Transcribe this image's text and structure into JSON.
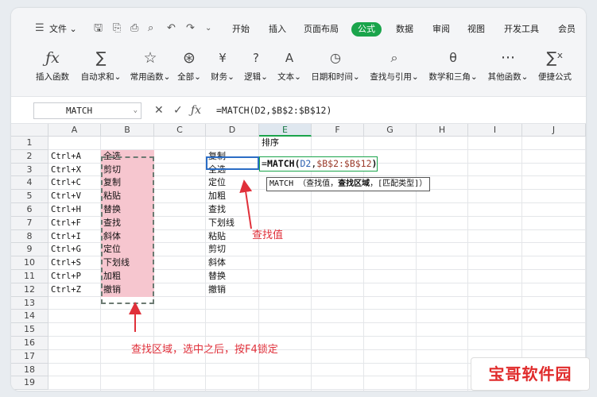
{
  "menubar": {
    "file_label": "文件",
    "items": [
      "开始",
      "插入",
      "页面布局",
      "公式",
      "数据",
      "审阅",
      "视图",
      "开发工具",
      "会员"
    ],
    "active": "公式"
  },
  "ribbon": {
    "buttons": [
      {
        "label": "插入函数",
        "icon": "fx-icon"
      },
      {
        "label": "自动求和",
        "icon": "sum-icon"
      },
      {
        "label": "常用函数",
        "icon": "star-icon"
      },
      {
        "label": "全部",
        "icon": "all-functions-icon"
      },
      {
        "label": "财务",
        "icon": "finance-icon"
      },
      {
        "label": "逻辑",
        "icon": "logic-icon"
      },
      {
        "label": "文本",
        "icon": "text-icon"
      },
      {
        "label": "日期和时间",
        "icon": "clock-icon"
      },
      {
        "label": "查找与引用",
        "icon": "lookup-icon"
      },
      {
        "label": "数学和三角",
        "icon": "math-icon"
      },
      {
        "label": "其他函数",
        "icon": "more-icon"
      },
      {
        "label": "便捷公式",
        "icon": "quick-formula-icon"
      }
    ]
  },
  "formula_bar": {
    "name_box": "MATCH",
    "formula": "=MATCH(D2,$B$2:$B$12)"
  },
  "columns": [
    "A",
    "B",
    "C",
    "D",
    "E",
    "F",
    "G",
    "H",
    "I",
    "J"
  ],
  "selected_column": "E",
  "rows": [
    "1",
    "2",
    "3",
    "4",
    "5",
    "6",
    "7",
    "8",
    "9",
    "10",
    "11",
    "12",
    "13",
    "14",
    "15",
    "16",
    "17",
    "18",
    "19"
  ],
  "col_a": [
    "Ctrl+A",
    "Ctrl+X",
    "Ctrl+C",
    "Ctrl+V",
    "Ctrl+H",
    "Ctrl+F",
    "Ctrl+I",
    "Ctrl+G",
    "Ctrl+S",
    "Ctrl+P",
    "Ctrl+Z"
  ],
  "col_b": [
    "全选",
    "剪切",
    "复制",
    "粘贴",
    "替换",
    "查找",
    "斜体",
    "定位",
    "下划线",
    "加粗",
    "撤销"
  ],
  "col_d": [
    "复制",
    "全选",
    "定位",
    "加粗",
    "查找",
    "下划线",
    "粘贴",
    "剪切",
    "斜体",
    "替换",
    "撤销"
  ],
  "e1": "排序",
  "edit_cell": {
    "eq": "=",
    "fn": "MATCH",
    "open": "(",
    "ref1": "D2",
    "comma": ",",
    "ref2": "$B$2:$B$12",
    "close": ")"
  },
  "tooltip": {
    "fn": "MATCH",
    "open": "（",
    "arg1": "查找值",
    "sep1": "，",
    "arg2": "查找区域",
    "sep2": "，",
    "arg3": "[匹配类型]",
    "close": "）"
  },
  "annotations": {
    "lookup_value": "查找值",
    "lookup_range": "查找区域，选中之后，按F4锁定"
  },
  "watermark": "宝哥软件园",
  "colors": {
    "accent": "#1aa44b",
    "highlight": "#f6c6cf",
    "annotation": "#e0303a"
  }
}
